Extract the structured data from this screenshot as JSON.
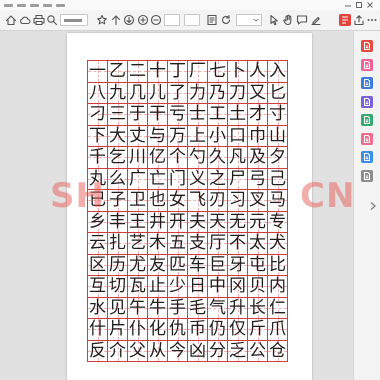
{
  "toolbar": {
    "icons": [
      "home-icon",
      "cloud-icon",
      "print-icon",
      "search-icon",
      "star-icon",
      "arrow-up-icon",
      "arrow-down-icon",
      "zoom-in-icon",
      "zoom-out-icon",
      "fit-page-icon",
      "rotate-icon",
      "select-icon",
      "hand-icon",
      "comment-icon",
      "sign-icon",
      "pdf-icon",
      "share-icon",
      "more-icon"
    ],
    "pdf_icon_color": "#e0443a"
  },
  "sheet": {
    "grid_color": "#d23c3c",
    "guide_color": "#f2b3b3",
    "rows": [
      [
        "一",
        "乙",
        "二",
        "十",
        "丁",
        "厂",
        "七",
        "卜",
        "人",
        "入"
      ],
      [
        "八",
        "九",
        "几",
        "儿",
        "了",
        "力",
        "乃",
        "刀",
        "又",
        "匕"
      ],
      [
        "刁",
        "三",
        "于",
        "干",
        "亏",
        "士",
        "工",
        "土",
        "才",
        "寸"
      ],
      [
        "下",
        "大",
        "丈",
        "与",
        "万",
        "上",
        "小",
        "口",
        "巾",
        "山"
      ],
      [
        "千",
        "乞",
        "川",
        "亿",
        "个",
        "勺",
        "久",
        "凡",
        "及",
        "夕"
      ],
      [
        "丸",
        "么",
        "广",
        "亡",
        "门",
        "义",
        "之",
        "尸",
        "弓",
        "己"
      ],
      [
        "已",
        "子",
        "卫",
        "也",
        "女",
        "飞",
        "刃",
        "习",
        "叉",
        "马"
      ],
      [
        "乡",
        "丰",
        "王",
        "井",
        "开",
        "夫",
        "天",
        "无",
        "元",
        "专"
      ],
      [
        "云",
        "扎",
        "艺",
        "木",
        "五",
        "支",
        "厅",
        "不",
        "太",
        "犬"
      ],
      [
        "区",
        "历",
        "尤",
        "友",
        "匹",
        "车",
        "巨",
        "牙",
        "屯",
        "比"
      ],
      [
        "互",
        "切",
        "瓦",
        "止",
        "少",
        "日",
        "中",
        "冈",
        "贝",
        "内"
      ],
      [
        "水",
        "见",
        "午",
        "牛",
        "手",
        "毛",
        "气",
        "升",
        "长",
        "仁"
      ],
      [
        "什",
        "片",
        "仆",
        "化",
        "仇",
        "币",
        "仍",
        "仅",
        "斤",
        "爪"
      ],
      [
        "反",
        "介",
        "父",
        "从",
        "今",
        "凶",
        "分",
        "乏",
        "公",
        "仓"
      ]
    ]
  },
  "watermark": {
    "left": "SH",
    "right": "CN",
    "color": "#e8605c"
  },
  "sidebar": {
    "tools": [
      {
        "icon": "red-document-tool-icon",
        "color": "#e5483d"
      },
      {
        "icon": "pink-document-tool-icon",
        "color": "#f06292"
      },
      {
        "icon": "blue-document-tool-icon",
        "color": "#3a7be0"
      },
      {
        "icon": "purple-document-tool-icon",
        "color": "#7b61d9"
      },
      {
        "icon": "green-document-tool-icon",
        "color": "#35a86b"
      },
      {
        "icon": "rose-document-tool-icon",
        "color": "#ef6c8a"
      },
      {
        "icon": "sky-document-tool-icon",
        "color": "#3a8ee6"
      },
      {
        "icon": "gray-document-tool-icon",
        "color": "#8c8c8c"
      }
    ],
    "collapse_icon": "chevron-right-icon"
  }
}
